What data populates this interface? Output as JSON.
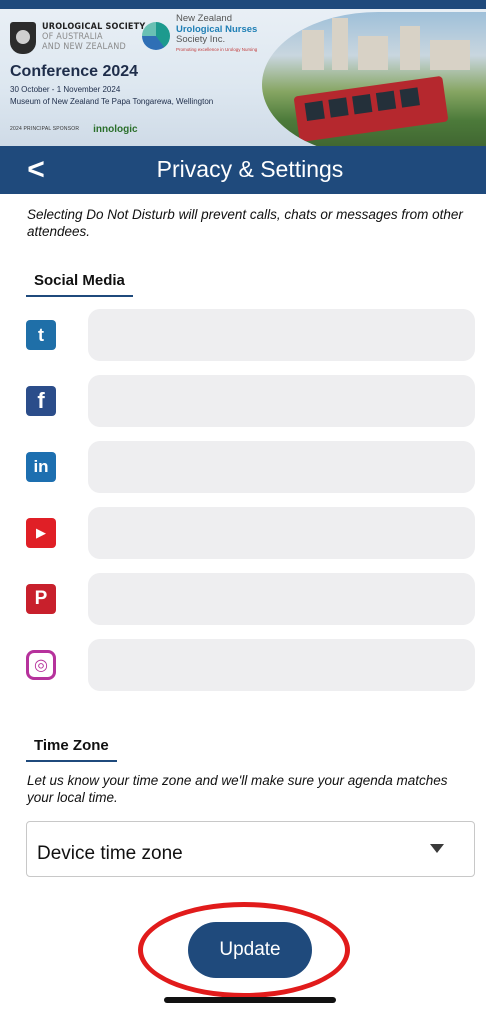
{
  "banner": {
    "usanz_line1": "UROLOGICAL SOCIETY",
    "usanz_line2": "OF AUSTRALIA",
    "usanz_line3": "AND NEW ZEALAND",
    "nzun_line1": "New Zealand",
    "nzun_line2": "Urological Nurses",
    "nzun_line3": "Society Inc.",
    "nzun_tagline": "Promoting excellence in Urology Nursing",
    "conference_title": "Conference 2024",
    "conference_dates": "30 October - 1 November 2024",
    "conference_venue": "Museum of New Zealand Te Papa Tongarewa, Wellington",
    "sponsor_label": "2024 PRINCIPAL SPONSOR",
    "sponsor_name": "innologic"
  },
  "header": {
    "back_icon": "chevron-left-icon",
    "back_glyph": "<",
    "title": "Privacy & Settings"
  },
  "notice": "Selecting Do Not Disturb will prevent calls, chats or messages from other attendees.",
  "social_media": {
    "heading": "Social Media",
    "items": [
      {
        "icon": "twitter-icon",
        "glyph": "t",
        "color": "#1f6fa8",
        "value": ""
      },
      {
        "icon": "facebook-icon",
        "glyph": "f",
        "color": "#2b4d8a",
        "value": ""
      },
      {
        "icon": "linkedin-icon",
        "glyph": "in",
        "color": "#1d6fb0",
        "value": ""
      },
      {
        "icon": "youtube-icon",
        "glyph": "▶",
        "color": "#e01f26",
        "value": ""
      },
      {
        "icon": "pinterest-icon",
        "glyph": "P",
        "color": "#c8202c",
        "value": ""
      },
      {
        "icon": "instagram-icon",
        "glyph": "◎",
        "color": "#b6329c",
        "value": ""
      }
    ]
  },
  "time_zone": {
    "heading": "Time Zone",
    "description": "Let us know your time zone and we'll make sure your agenda matches your local time.",
    "selected": "Device time zone"
  },
  "update_button": "Update",
  "colors": {
    "primary": "#1f4a7c",
    "highlight_ring": "#e11b1b",
    "field_bg": "#eeeef0"
  }
}
